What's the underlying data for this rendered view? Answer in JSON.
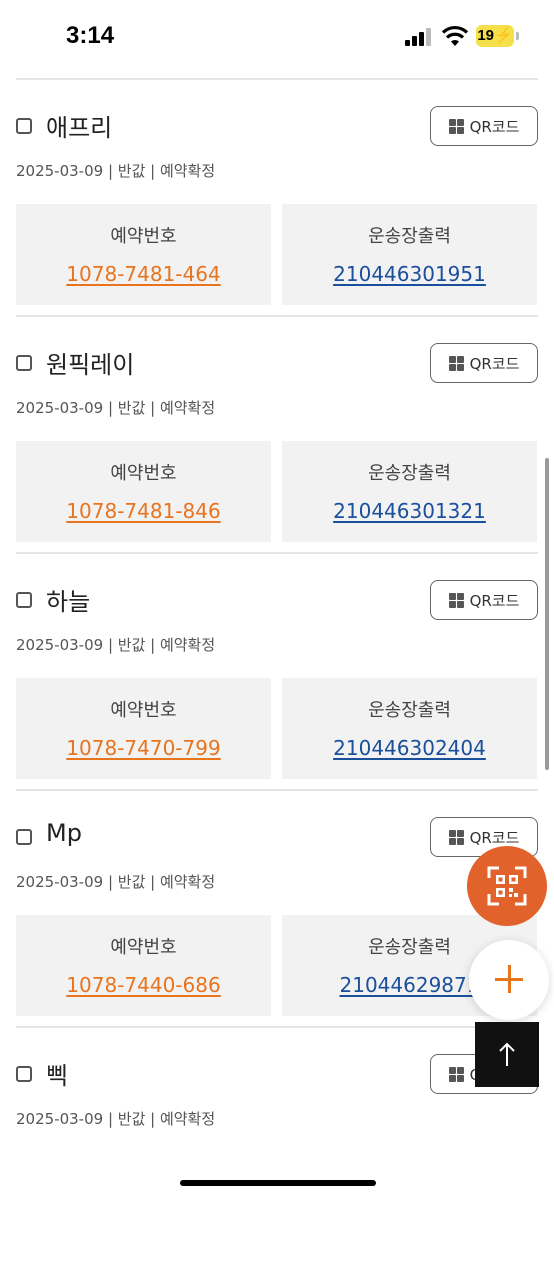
{
  "status_bar": {
    "time": "3:14",
    "battery": "19"
  },
  "qr_label": "QR코드",
  "labels": {
    "reservation": "예약번호",
    "shipping": "운송장출력"
  },
  "items": [
    {
      "name": "애프리",
      "meta": "2025-03-09 | 반값 | 예약확정",
      "reservation_no": "1078-7481-464",
      "tracking_no": "210446301951"
    },
    {
      "name": "원픽레이",
      "meta": "2025-03-09 | 반값 | 예약확정",
      "reservation_no": "1078-7481-846",
      "tracking_no": "210446301321"
    },
    {
      "name": "하늘",
      "meta": "2025-03-09 | 반값 | 예약확정",
      "reservation_no": "1078-7470-799",
      "tracking_no": "210446302404"
    },
    {
      "name": "Mp",
      "meta": "2025-03-09 | 반값 | 예약확정",
      "reservation_no": "1078-7440-686",
      "tracking_no": "21044629871"
    },
    {
      "name": "삑",
      "meta": "2025-03-09 | 반값 | 예약확정"
    }
  ],
  "colors": {
    "accent": "#e8741e",
    "link_blue": "#1a4f9c",
    "fab_qr": "#e1622b"
  },
  "icons": {
    "qr_fab": "qr-scan-icon",
    "add": "plus-icon",
    "top": "arrow-up-icon"
  }
}
